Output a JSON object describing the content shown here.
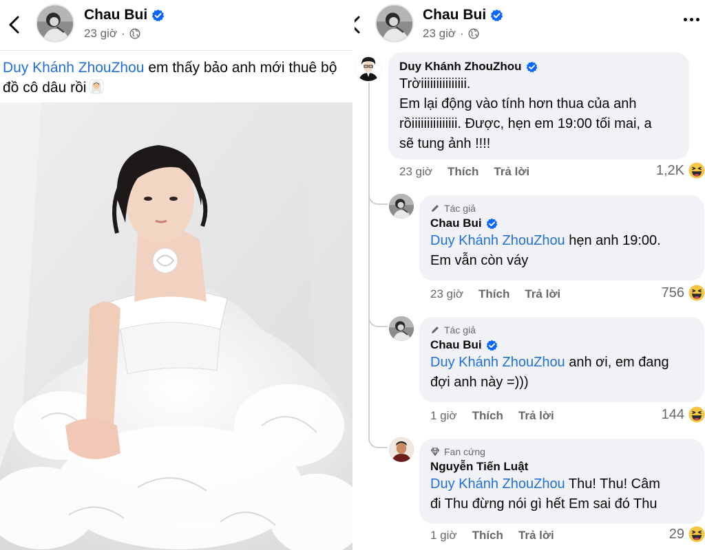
{
  "left_panel": {
    "author": "Chau Bui",
    "time": "23 giờ",
    "caption_mention": "Duy Khánh ZhouZhou",
    "caption_line1": "em thấy bảo anh mới thuê bộ",
    "caption_line2": "đồ cô dâu rồi"
  },
  "right_panel": {
    "author": "Chau Bui",
    "time": "23 giờ",
    "comments": [
      {
        "name": "Duy Khánh ZhouZhou",
        "lines": [
          "Trờiiiiiiiiiiiiiii.",
          "Em lại động vào tính hơn thua của anh",
          "rồiiiiiiiiiiiiiii. Được, hẹn em 19:00 tối mai, a",
          "sẽ tung ảnh !!!!"
        ],
        "time": "23 giờ",
        "like": "Thích",
        "reply": "Trả lời",
        "reactions": "1,2K"
      },
      {
        "badge": "Tác giả",
        "name": "Chau Bui",
        "mention": "Duy Khánh ZhouZhou",
        "line1_rest": "hẹn anh 19:00.",
        "line2": "Em vẫn còn váy",
        "time": "23 giờ",
        "like": "Thích",
        "reply": "Trả lời",
        "reactions": "756"
      },
      {
        "badge": "Tác giả",
        "name": "Chau Bui",
        "mention": "Duy Khánh ZhouZhou",
        "line1_rest": "anh ơi, em đang",
        "line2": "đợi anh này =)))",
        "time": "1 giờ",
        "like": "Thích",
        "reply": "Trả lời",
        "reactions": "144"
      },
      {
        "badge": "Fan cứng",
        "name": "Nguyễn Tiến Luật",
        "mention": "Duy Khánh ZhouZhou",
        "line1_rest": "Thu! Thu! Câm",
        "line2": "đi Thu đừng nói gì hết Em sai đó Thu",
        "time": "1 giờ",
        "like": "Thích",
        "reply": "Trả lời",
        "reactions": "29"
      }
    ]
  },
  "colors": {
    "link": "#216fdb",
    "verified": "#0866ff",
    "muted": "#65676b",
    "bubble": "#f0f2f5"
  }
}
